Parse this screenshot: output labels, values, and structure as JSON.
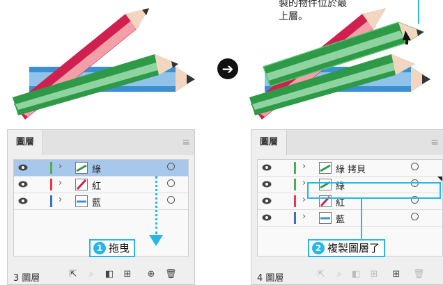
{
  "top_callout": "製的物件位於最上層。",
  "transition_arrow": "➔",
  "left_panel": {
    "tab": "圖層",
    "layers": [
      {
        "name": "綠",
        "color": "#4caf50",
        "selected": true
      },
      {
        "name": "紅",
        "color": "#e53945",
        "selected": false
      },
      {
        "name": "藍",
        "color": "#3a6fc4",
        "selected": false
      }
    ],
    "count": "3 圖層",
    "step_number": "1",
    "step_label": "拖曳"
  },
  "right_panel": {
    "tab": "圖層",
    "layers": [
      {
        "name": "綠 拷貝",
        "color": "#4caf50",
        "selected": false
      },
      {
        "name": "綠",
        "color": "#4caf50",
        "selected": false
      },
      {
        "name": "紅",
        "color": "#e53945",
        "selected": false
      },
      {
        "name": "藍",
        "color": "#3a6fc4",
        "selected": false
      }
    ],
    "count": "4 圖層",
    "step_number": "2",
    "step_label": "複製圖層了"
  },
  "icons": {
    "menu": "hamburger-icon",
    "eye": "eye-icon",
    "expand": "chevron-right-icon",
    "target": "target-circle-icon",
    "footer": [
      "export-icon",
      "search-icon",
      "mask-icon",
      "sublayer-icon",
      "new-layer-icon",
      "trash-icon"
    ]
  },
  "accent_color": "#29b6e6"
}
